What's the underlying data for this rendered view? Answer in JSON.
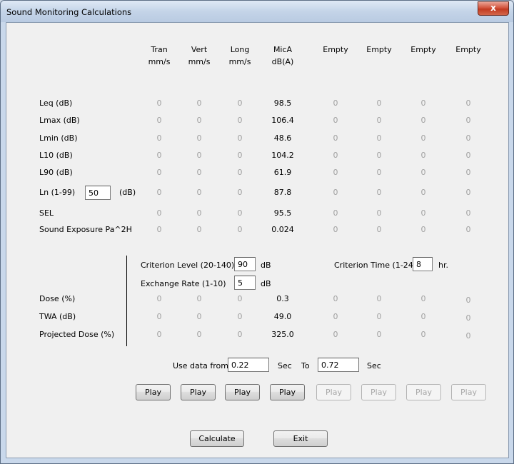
{
  "window": {
    "title": "Sound Monitoring Calculations",
    "close_glyph": "x"
  },
  "columns": [
    {
      "line1": "Tran",
      "line2": "mm/s"
    },
    {
      "line1": "Vert",
      "line2": "mm/s"
    },
    {
      "line1": "Long",
      "line2": "mm/s"
    },
    {
      "line1": "MicA",
      "line2": "dB(A)"
    },
    {
      "line1": "Empty",
      "line2": ""
    },
    {
      "line1": "Empty",
      "line2": ""
    },
    {
      "line1": "Empty",
      "line2": ""
    },
    {
      "line1": "Empty",
      "line2": ""
    }
  ],
  "rows": [
    {
      "label": "Leq (dB)",
      "values": [
        "0",
        "0",
        "0",
        "98.5",
        "0",
        "0",
        "0",
        "0"
      ]
    },
    {
      "label": "Lmax (dB)",
      "values": [
        "0",
        "0",
        "0",
        "106.4",
        "0",
        "0",
        "0",
        "0"
      ]
    },
    {
      "label": "Lmin (dB)",
      "values": [
        "0",
        "0",
        "0",
        "48.6",
        "0",
        "0",
        "0",
        "0"
      ]
    },
    {
      "label": "L10 (dB)",
      "values": [
        "0",
        "0",
        "0",
        "104.2",
        "0",
        "0",
        "0",
        "0"
      ]
    },
    {
      "label": "L90 (dB)",
      "values": [
        "0",
        "0",
        "0",
        "61.9",
        "0",
        "0",
        "0",
        "0"
      ]
    },
    {
      "label": "Ln (1-99)",
      "values": [
        "0",
        "0",
        "0",
        "87.8",
        "0",
        "0",
        "0",
        "0"
      ]
    },
    {
      "label": "SEL",
      "values": [
        "0",
        "0",
        "0",
        "95.5",
        "0",
        "0",
        "0",
        "0"
      ]
    },
    {
      "label": "Sound Exposure Pa^2H",
      "values": [
        "0",
        "0",
        "0",
        "0.024",
        "0",
        "0",
        "0",
        "0"
      ]
    }
  ],
  "ln": {
    "value": "50",
    "unit": "(dB)"
  },
  "criterion_level": {
    "label": "Criterion Level (20-140)",
    "value": "90",
    "unit": "dB"
  },
  "exchange_rate": {
    "label": "Exchange Rate (1-10)",
    "value": "5",
    "unit": "dB"
  },
  "criterion_time": {
    "label": "Criterion Time (1-24)",
    "value": "8",
    "unit": "hr."
  },
  "dose_rows": [
    {
      "label": "Dose (%)",
      "values": [
        "0",
        "0",
        "0",
        "0.3",
        "0",
        "0",
        "0",
        "0"
      ]
    },
    {
      "label": "TWA (dB)",
      "values": [
        "0",
        "0",
        "0",
        "49.0",
        "0",
        "0",
        "0",
        "0"
      ]
    },
    {
      "label": "Projected Dose (%)",
      "values": [
        "0",
        "0",
        "0",
        "325.0",
        "0",
        "0",
        "0",
        "0"
      ]
    }
  ],
  "range": {
    "label": "Use data from",
    "from": "0.22",
    "from_unit": "Sec",
    "to_label": "To",
    "to": "0.72",
    "to_unit": "Sec"
  },
  "play_buttons": [
    {
      "label": "Play",
      "enabled": true
    },
    {
      "label": "Play",
      "enabled": true
    },
    {
      "label": "Play",
      "enabled": true
    },
    {
      "label": "Play",
      "enabled": true
    },
    {
      "label": "Play",
      "enabled": false
    },
    {
      "label": "Play",
      "enabled": false
    },
    {
      "label": "Play",
      "enabled": false
    },
    {
      "label": "Play",
      "enabled": false
    }
  ],
  "actions": {
    "calculate": "Calculate",
    "exit": "Exit"
  }
}
